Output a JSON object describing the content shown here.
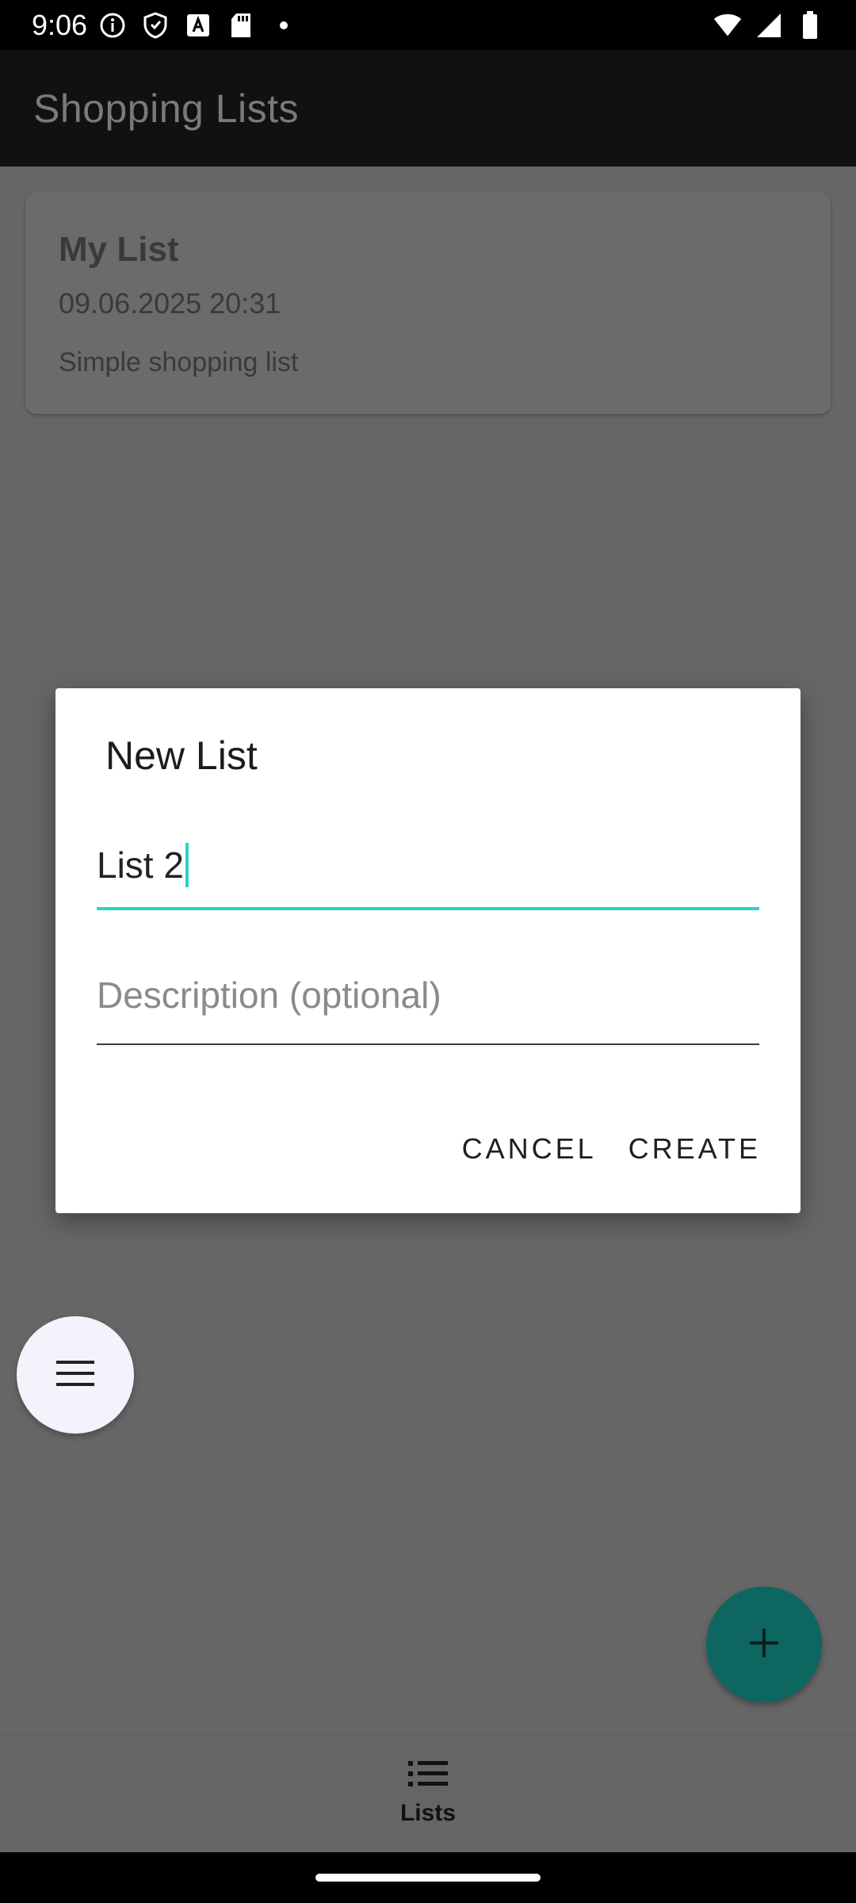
{
  "status_bar": {
    "time": "9:06",
    "left_icons": [
      "info-icon",
      "shield-icon",
      "a-box-icon",
      "sd-card-icon",
      "dot-icon"
    ],
    "right_icons": [
      "wifi-icon",
      "signal-icon",
      "battery-icon"
    ]
  },
  "app_bar": {
    "title": "Shopping Lists"
  },
  "lists": [
    {
      "title": "My List",
      "date": "09.06.2025 20:31",
      "description": "Simple shopping list"
    }
  ],
  "dialog": {
    "title": "New List",
    "name_value": "List 2",
    "description_placeholder": "Description (optional)",
    "cancel_label": "CANCEL",
    "create_label": "CREATE"
  },
  "bottom_nav": {
    "items": [
      {
        "label": "Lists",
        "icon": "list-icon"
      }
    ]
  },
  "colors": {
    "accent": "#2bd3c0",
    "fab_add": "#0e6660",
    "fab_menu": "#f4f2fa",
    "scrim_bg": "#666666"
  }
}
